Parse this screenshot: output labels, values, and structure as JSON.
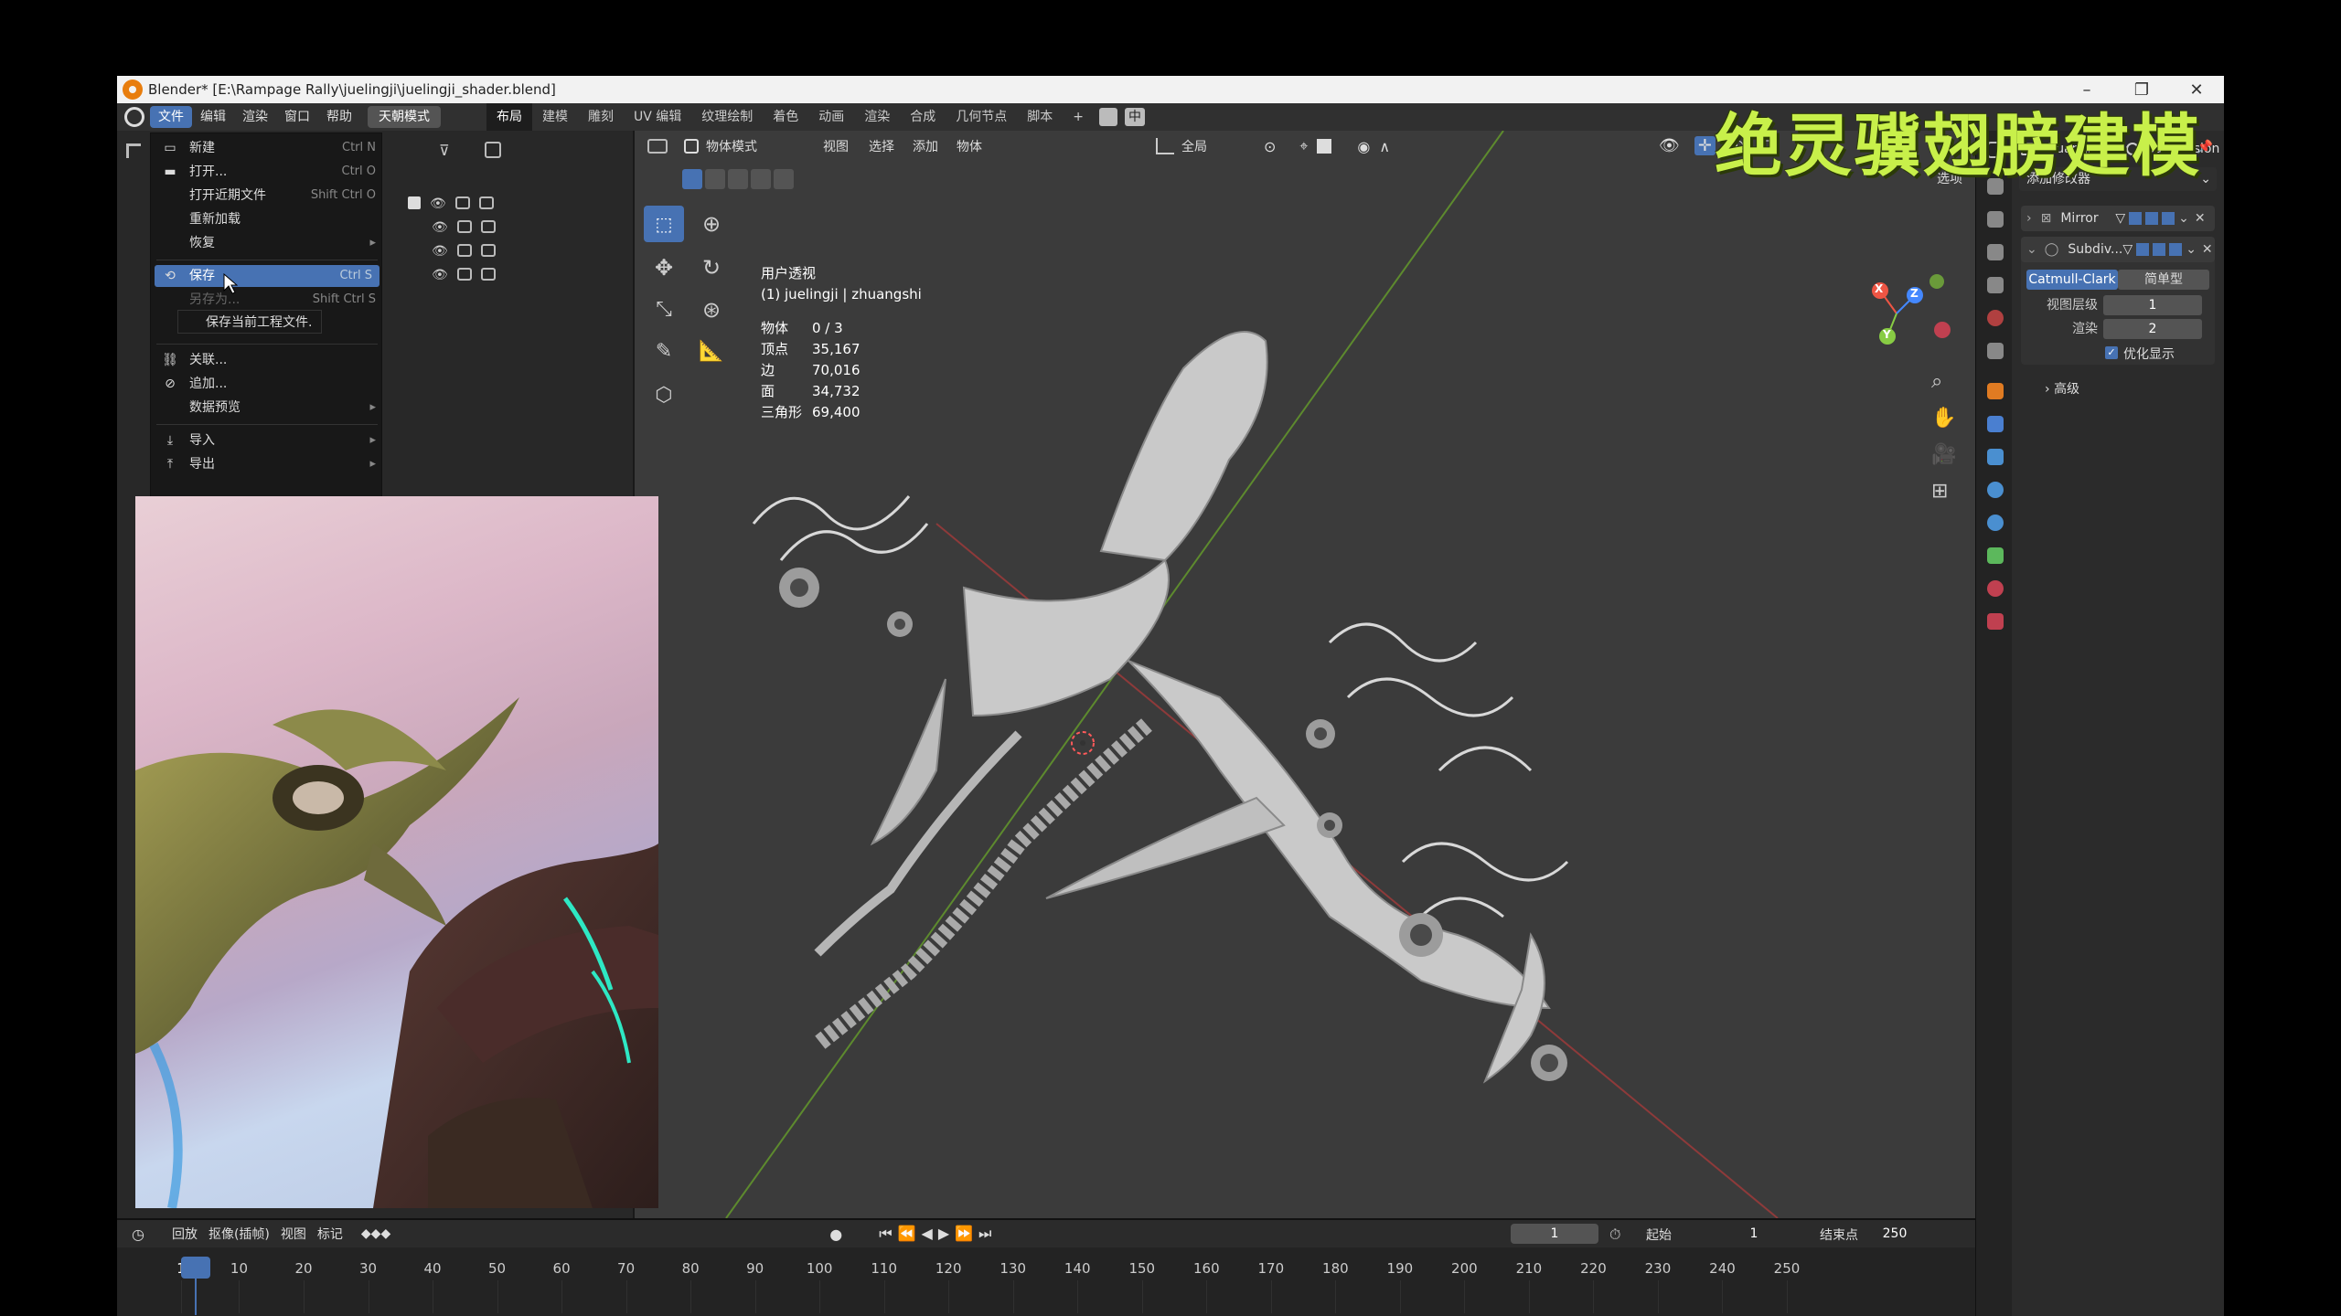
{
  "window": {
    "title": "Blender* [E:\\Rampage Rally\\juelingji\\juelingji_shader.blend]"
  },
  "overlay_title": "绝灵骥翅膀建模",
  "menubar": {
    "menus": [
      "文件",
      "编辑",
      "渲染",
      "窗口",
      "帮助"
    ],
    "mode_button": "天朝模式",
    "workspaces": [
      "布局",
      "建模",
      "雕刻",
      "UV 编辑",
      "纹理绘制",
      "着色",
      "动画",
      "渲染",
      "合成",
      "几何节点",
      "脚本"
    ],
    "add_tab": "+",
    "ime": "中"
  },
  "file_menu": {
    "items": [
      {
        "label": "新建",
        "shortcut": "Ctrl N"
      },
      {
        "label": "打开...",
        "shortcut": "Ctrl O"
      },
      {
        "label": "打开近期文件",
        "shortcut": "Shift Ctrl O"
      },
      {
        "label": "重新加载",
        "shortcut": ""
      },
      {
        "label": "恢复",
        "shortcut": ""
      },
      {
        "label": "保存",
        "shortcut": "Ctrl S"
      },
      {
        "label": "另存为...",
        "shortcut": "Shift Ctrl S"
      },
      {
        "label": "关联...",
        "shortcut": ""
      },
      {
        "label": "追加...",
        "shortcut": ""
      },
      {
        "label": "数据预览",
        "shortcut": ""
      },
      {
        "label": "导入",
        "shortcut": ""
      },
      {
        "label": "导出",
        "shortcut": ""
      }
    ],
    "tooltip": "保存当前工程文件."
  },
  "viewport": {
    "mode": "物体模式",
    "menus": [
      "视图",
      "选择",
      "添加",
      "物体"
    ],
    "transform_orientation": "全局",
    "options_label": "选项",
    "view_name": "用户透视",
    "object_name": "(1) juelingji | zhuangshi",
    "stats": [
      {
        "label": "物体",
        "value": "0 / 3"
      },
      {
        "label": "顶点",
        "value": "35,167"
      },
      {
        "label": "边",
        "value": "70,016"
      },
      {
        "label": "面",
        "value": "34,732"
      },
      {
        "label": "三角形",
        "value": "69,400"
      }
    ],
    "gizmo": {
      "x": "X",
      "y": "Y",
      "z": "Z"
    }
  },
  "properties": {
    "breadcrumb_object": "zhuangshi",
    "breadcrumb_modifier": "Subdivision",
    "add_modifier": "添加修改器",
    "modifiers": [
      {
        "name": "Mirror"
      },
      {
        "name": "Subdiv..."
      }
    ],
    "subdiv_types": [
      "Catmull-Clark",
      "简单型"
    ],
    "viewport_levels_label": "视图层级",
    "viewport_levels": "1",
    "render_label": "渲染",
    "render_levels": "2",
    "optimal_display": "优化显示",
    "advanced": "高级"
  },
  "timeline": {
    "menus": [
      "回放",
      "抠像(插帧)",
      "视图",
      "标记"
    ],
    "current_frame": "1",
    "start_label": "起始",
    "start": "1",
    "end_label": "结束点",
    "end": "250",
    "ticks": [
      "1",
      "10",
      "20",
      "30",
      "40",
      "50",
      "60",
      "70",
      "80",
      "90",
      "100",
      "110",
      "120",
      "130",
      "140",
      "150",
      "160",
      "170",
      "180",
      "190",
      "200",
      "210",
      "220",
      "230",
      "240",
      "250"
    ]
  },
  "colors": {
    "accent": "#4772b3",
    "overlay_text": "#c8f04a",
    "viewport_bg": "#3b3b3b"
  }
}
